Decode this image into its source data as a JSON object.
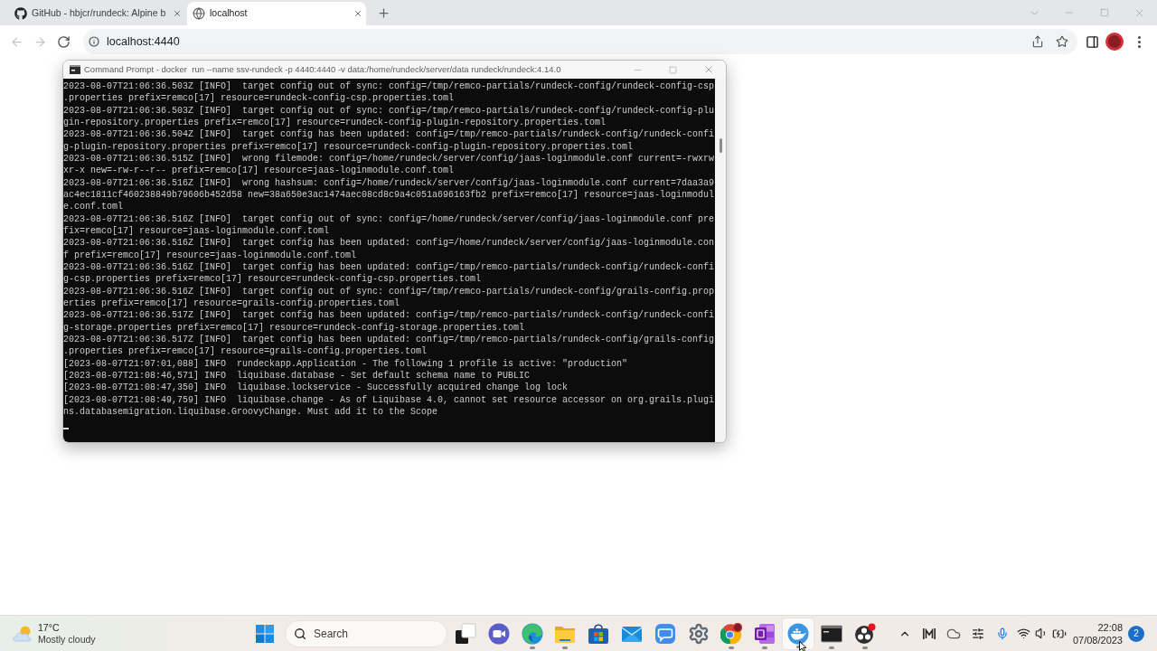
{
  "browser": {
    "tabs": [
      {
        "title": "GitHub - hbjcr/rundeck: Alpine b",
        "kind": "github",
        "selected": false
      },
      {
        "title": "localhost",
        "kind": "globe",
        "selected": true
      }
    ],
    "nav_buttons": [
      {
        "kind": "back",
        "disabled": true
      },
      {
        "kind": "forward",
        "disabled": true
      },
      {
        "kind": "reload",
        "disabled": false
      }
    ],
    "address": {
      "value": "localhost:4440"
    }
  },
  "console_window": {
    "title": "Command Prompt - docker  run --name ssv-rundeck -p 4440:4440 -v data:/home/rundeck/server/data rundeck/rundeck:4.14.0",
    "lines": [
      "2023-08-07T21:06:36.503Z [INFO]  target config out of sync: config=/tmp/remco-partials/rundeck-config/rundeck-config-csp.properties prefix=remco[17] resource=rundeck-config-csp.properties.toml",
      "2023-08-07T21:06:36.503Z [INFO]  target config out of sync: config=/tmp/remco-partials/rundeck-config/rundeck-config-plugin-repository.properties prefix=remco[17] resource=rundeck-config-plugin-repository.properties.toml",
      "2023-08-07T21:06:36.504Z [INFO]  target config has been updated: config=/tmp/remco-partials/rundeck-config/rundeck-config-plugin-repository.properties prefix=remco[17] resource=rundeck-config-plugin-repository.properties.toml",
      "2023-08-07T21:06:36.515Z [INFO]  wrong filemode: config=/home/rundeck/server/config/jaas-loginmodule.conf current=-rwxrwxr-x new=-rw-r--r-- prefix=remco[17] resource=jaas-loginmodule.conf.toml",
      "2023-08-07T21:06:36.516Z [INFO]  wrong hashsum: config=/home/rundeck/server/config/jaas-loginmodule.conf current=7daa3a9ac4ec1811cf460238849b79606b452d58 new=38a650e3ac1474aec08cd8c9a4c051a696163fb2 prefix=remco[17] resource=jaas-loginmodule.conf.toml",
      "2023-08-07T21:06:36.516Z [INFO]  target config out of sync: config=/home/rundeck/server/config/jaas-loginmodule.conf prefix=remco[17] resource=jaas-loginmodule.conf.toml",
      "2023-08-07T21:06:36.516Z [INFO]  target config has been updated: config=/home/rundeck/server/config/jaas-loginmodule.conf prefix=remco[17] resource=jaas-loginmodule.conf.toml",
      "2023-08-07T21:06:36.516Z [INFO]  target config has been updated: config=/tmp/remco-partials/rundeck-config/rundeck-config-csp.properties prefix=remco[17] resource=rundeck-config-csp.properties.toml",
      "2023-08-07T21:06:36.516Z [INFO]  target config out of sync: config=/tmp/remco-partials/rundeck-config/grails-config.properties prefix=remco[17] resource=grails-config.properties.toml",
      "2023-08-07T21:06:36.517Z [INFO]  target config has been updated: config=/tmp/remco-partials/rundeck-config/rundeck-config-storage.properties prefix=remco[17] resource=rundeck-config-storage.properties.toml",
      "2023-08-07T21:06:36.517Z [INFO]  target config has been updated: config=/tmp/remco-partials/rundeck-config/grails-config.properties prefix=remco[17] resource=grails-config.properties.toml",
      "[2023-08-07T21:07:01,088] INFO  rundeckapp.Application - The following 1 profile is active: \"production\"",
      "[2023-08-07T21:08:46,571] INFO  liquibase.database - Set default schema name to PUBLIC",
      "[2023-08-07T21:08:47,350] INFO  liquibase.lockservice - Successfully acquired change log lock",
      "[2023-08-07T21:08:49,759] INFO  liquibase.change - As of Liquibase 4.0, cannot set resource accessor on org.grails.plugins.databasemigration.liquibase.GroovyChange. Must add it to the Scope"
    ]
  },
  "taskbar": {
    "weather": {
      "temperature": "17°C",
      "condition": "Mostly cloudy"
    },
    "search": {
      "placeholder": "Search"
    },
    "apps": [
      {
        "kind": "taskview",
        "running": false,
        "highlighted": false
      },
      {
        "kind": "meet",
        "running": false,
        "highlighted": false
      },
      {
        "kind": "edge",
        "running": true,
        "highlighted": false
      },
      {
        "kind": "explorer",
        "running": true,
        "highlighted": false
      },
      {
        "kind": "store",
        "running": false,
        "highlighted": false
      },
      {
        "kind": "mail",
        "running": false,
        "highlighted": false
      },
      {
        "kind": "chat",
        "running": false,
        "highlighted": false
      },
      {
        "kind": "settings",
        "running": false,
        "highlighted": false
      },
      {
        "kind": "chrome",
        "running": true,
        "highlighted": false
      },
      {
        "kind": "onenote",
        "running": true,
        "highlighted": false
      },
      {
        "kind": "docker",
        "running": true,
        "highlighted": true
      },
      {
        "kind": "terminal",
        "running": true,
        "highlighted": false
      },
      {
        "kind": "obs",
        "running": true,
        "highlighted": false
      }
    ],
    "clock": {
      "time": "22:08",
      "date": "07/08/2023"
    },
    "notifications": "2"
  }
}
